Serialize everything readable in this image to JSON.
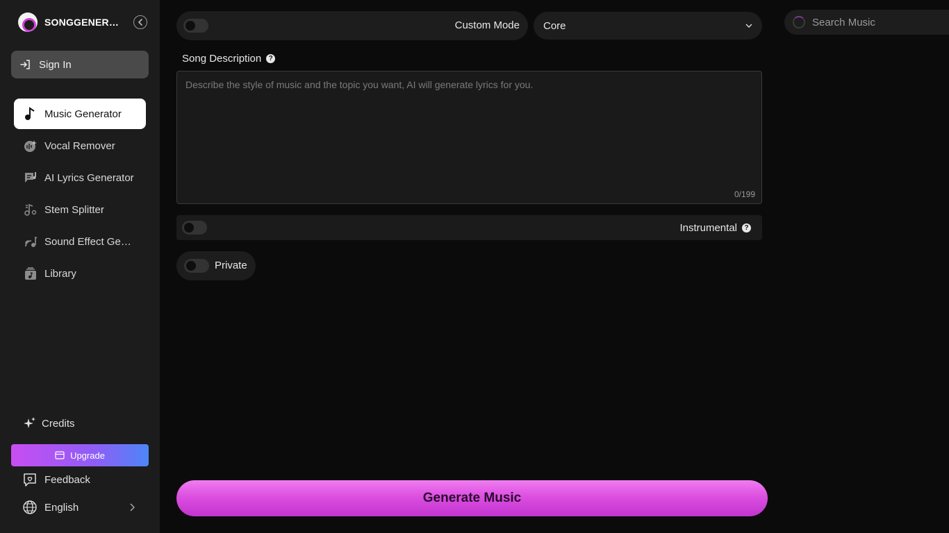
{
  "brand": {
    "name": "SONGGENERA..."
  },
  "sidebar": {
    "sign_in": "Sign In",
    "items": [
      {
        "label": "Music Generator",
        "icon": "music-note-icon",
        "active": true
      },
      {
        "label": "Vocal Remover",
        "icon": "vocal-remover-icon"
      },
      {
        "label": "AI Lyrics Generator",
        "icon": "lyrics-icon"
      },
      {
        "label": "Stem Splitter",
        "icon": "stem-splitter-icon"
      },
      {
        "label": "Sound Effect Gen...",
        "icon": "sound-effect-icon"
      },
      {
        "label": "Library",
        "icon": "library-icon"
      }
    ],
    "credits": "Credits",
    "upgrade": "Upgrade",
    "feedback": "Feedback",
    "language": "English"
  },
  "main": {
    "custom_mode_label": "Custom Mode",
    "custom_mode_on": false,
    "model": "Core",
    "song_description_label": "Song Description",
    "description_placeholder": "Describe the style of music and the topic you want, AI will generate lyrics for you.",
    "description_value": "",
    "char_counter": "0/199",
    "instrumental_label": "Instrumental",
    "instrumental_on": false,
    "private_label": "Private",
    "private_on": false,
    "generate_label": "Generate Music"
  },
  "search": {
    "placeholder": "Search Music"
  },
  "colors": {
    "accent_gradient_start": "#f07df0",
    "accent_gradient_end": "#c234d0",
    "upgrade_start": "#c84ef2",
    "upgrade_end": "#4d86f7",
    "sidebar_bg": "#1c1c1c",
    "page_bg": "#0b0b0b"
  }
}
